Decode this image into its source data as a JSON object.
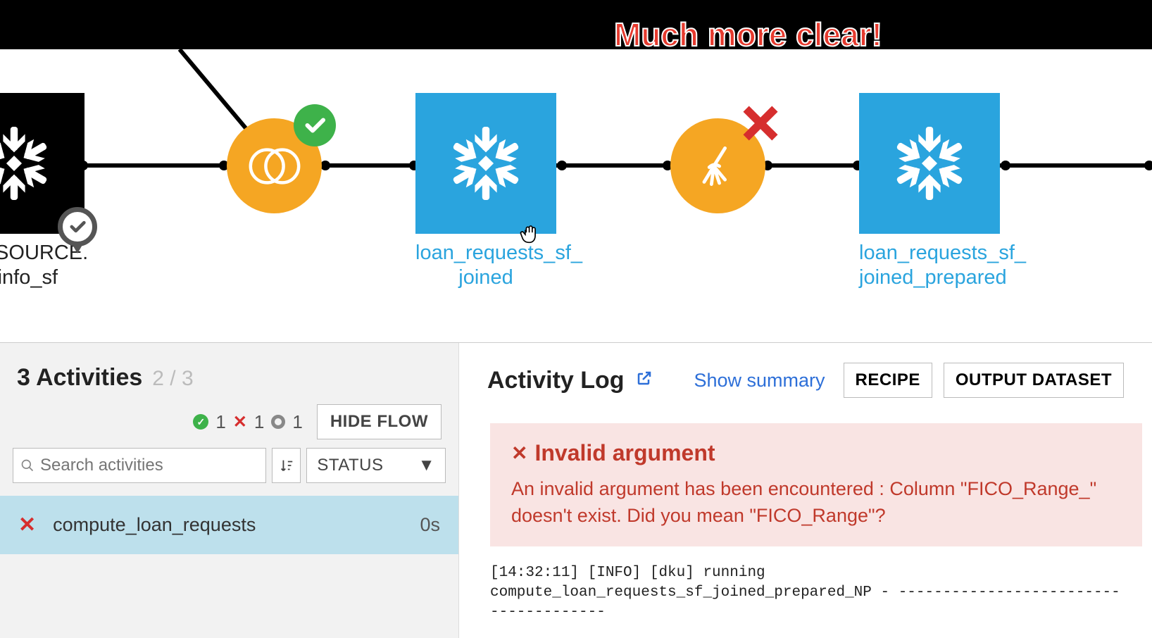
{
  "annotation": "Much more clear!",
  "flow": {
    "node1_label": "DATASOURCE.\nst_info_sf",
    "node2_label": "loan_requests_sf_\njoined",
    "node3_label": "loan_requests_sf_\njoined_prepared"
  },
  "activities": {
    "title": "3 Activities",
    "count": "2 / 3",
    "success": "1",
    "failed": "1",
    "pending": "1",
    "hide_flow": "HIDE FLOW",
    "search_placeholder": "Search activities",
    "status_label": "STATUS",
    "row1_name": "compute_loan_requests",
    "row1_dur": "0s"
  },
  "log": {
    "title": "Activity Log",
    "show_summary": "Show summary",
    "recipe_btn": "RECIPE",
    "output_btn": "OUTPUT DATASET",
    "error_title": "Invalid argument",
    "error_msg": "An invalid argument has been encountered : Column \"FICO_Range_\" doesn't exist. Did you mean \"FICO_Range\"?",
    "log_text": "[14:32:11] [INFO] [dku] running\ncompute_loan_requests_sf_joined_prepared_NP - --------------------------------------"
  }
}
